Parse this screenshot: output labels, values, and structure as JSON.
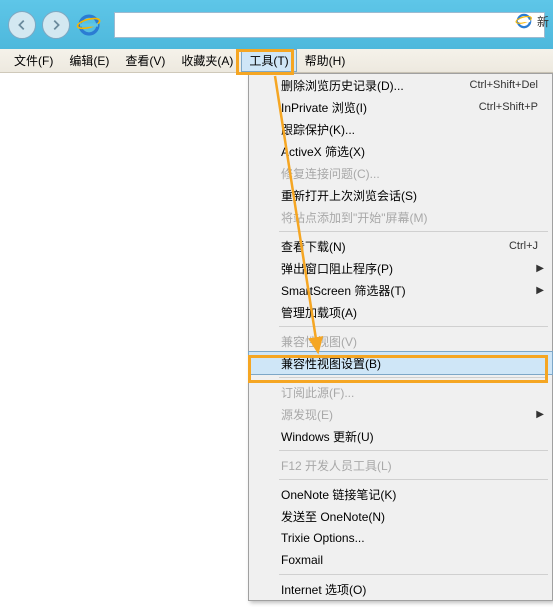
{
  "titlebar": {
    "new_tab_text": "新"
  },
  "menubar": {
    "file": "文件(F)",
    "edit": "编辑(E)",
    "view": "查看(V)",
    "favorites": "收藏夹(A)",
    "tools": "工具(T)",
    "help": "帮助(H)"
  },
  "menu": {
    "delete_history": "删除浏览历史记录(D)...",
    "delete_history_sc": "Ctrl+Shift+Del",
    "inprivate": "InPrivate 浏览(I)",
    "inprivate_sc": "Ctrl+Shift+P",
    "tracking": "跟踪保护(K)...",
    "activex": "ActiveX 筛选(X)",
    "fix_conn": "修复连接问题(C)...",
    "reopen": "重新打开上次浏览会话(S)",
    "add_start": "将站点添加到\"开始\"屏幕(M)",
    "downloads": "查看下载(N)",
    "downloads_sc": "Ctrl+J",
    "popup": "弹出窗口阻止程序(P)",
    "smartscreen": "SmartScreen 筛选器(T)",
    "addons": "管理加载项(A)",
    "compat_view": "兼容性视图(V)",
    "compat_settings": "兼容性视图设置(B)",
    "subscribe": "订阅此源(F)...",
    "feed_discovery": "源发现(E)",
    "win_update": "Windows 更新(U)",
    "f12": "F12 开发人员工具(L)",
    "onenote_link": "OneNote 链接笔记(K)",
    "send_onenote": "发送至 OneNote(N)",
    "trixie": "Trixie Options...",
    "foxmail": "Foxmail",
    "options": "Internet 选项(O)"
  }
}
